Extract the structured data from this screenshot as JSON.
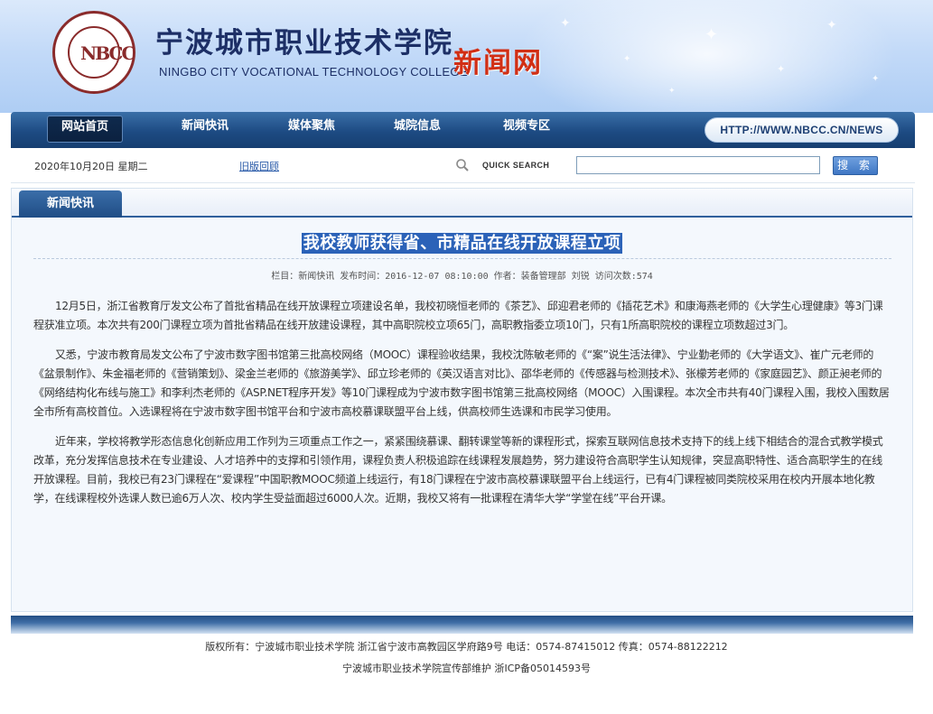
{
  "header": {
    "logo_text": "NBCC",
    "college_name_cn": "宁波城市职业技术学院",
    "college_name_en": "NINGBO CITY VOCATIONAL TECHNOLOGY COLLEGE",
    "site_name": "新闻网"
  },
  "nav": {
    "items": [
      {
        "label": "网站首页",
        "active": true
      },
      {
        "label": "新闻快讯"
      },
      {
        "label": "媒体聚焦"
      },
      {
        "label": "城院信息"
      },
      {
        "label": "视频专区"
      }
    ],
    "url": "HTTP://WWW.NBCC.CN/NEWS"
  },
  "infobar": {
    "date": "2020年10月20日  星期二",
    "old_version_link": "旧版回顾",
    "quick_search_label": "QUICK SEARCH",
    "search_value": "",
    "search_button": "搜 索"
  },
  "panel": {
    "tab_label": "新闻快讯"
  },
  "article": {
    "title": "我校教师获得省、市精品在线开放课程立项",
    "meta": "栏目：新闻快讯   发布时间：2016-12-07 08:10:00   作者：装备管理部 刘锐   访问次数:574",
    "paragraphs": [
      "12月5日，浙江省教育厅发文公布了首批省精品在线开放课程立项建设名单，我校初晓恒老师的《茶艺》、邱迎君老师的《插花艺术》和康海燕老师的《大学生心理健康》等3门课程获准立项。本次共有200门课程立项为首批省精品在线开放建设课程，其中高职院校立项65门，高职教指委立项10门，只有1所高职院校的课程立项数超过3门。",
      "又悉，宁波市教育局发文公布了宁波市数字图书馆第三批高校网络（MOOC）课程验收结果，我校沈陈敏老师的《“案”说生活法律》、宁业勤老师的《大学语文》、崔广元老师的《盆景制作》、朱金福老师的《营销策划》、梁金兰老师的《旅游美学》、邱立珍老师的《英汉语言对比》、邵华老师的《传感器与检测技术》、张檬芳老师的《家庭园艺》、颜正昶老师的《网络结构化布线与施工》和李利杰老师的《ASP.NET程序开发》等10门课程成为宁波市数字图书馆第三批高校网络（MOOC）入围课程。本次全市共有40门课程入围，我校入围数居全市所有高校首位。入选课程将在宁波市数字图书馆平台和宁波市高校慕课联盟平台上线，供高校师生选课和市民学习使用。",
      "近年来，学校将教学形态信息化创新应用工作列为三项重点工作之一，紧紧围绕慕课、翻转课堂等新的课程形式，探索互联网信息技术支持下的线上线下相结合的混合式教学模式改革，充分发挥信息技术在专业建设、人才培养中的支撑和引领作用，课程负责人积极追踪在线课程发展趋势，努力建设符合高职学生认知规律，突显高职特性、适合高职学生的在线开放课程。目前，我校已有23门课程在“爱课程”中国职教MOOC频道上线运行，有18门课程在宁波市高校慕课联盟平台上线运行，已有4门课程被同类院校采用在校内开展本地化教学，在线课程校外选课人数已逾6万人次、校内学生受益面超过6000人次。近期，我校又将有一批课程在清华大学“学堂在线”平台开课。"
    ]
  },
  "footer": {
    "line1": "版权所有：宁波城市职业技术学院 浙江省宁波市高教园区学府路9号 电话：0574-87415012 传真：0574-88122212",
    "line2": "宁波城市职业技术学院宣传部维护 浙ICP备05014593号"
  },
  "colors": {
    "nav_bg": "#1d4b83",
    "site_name": "#d12f15",
    "title_highlight": "#2b62b8",
    "link": "#2456a6"
  }
}
